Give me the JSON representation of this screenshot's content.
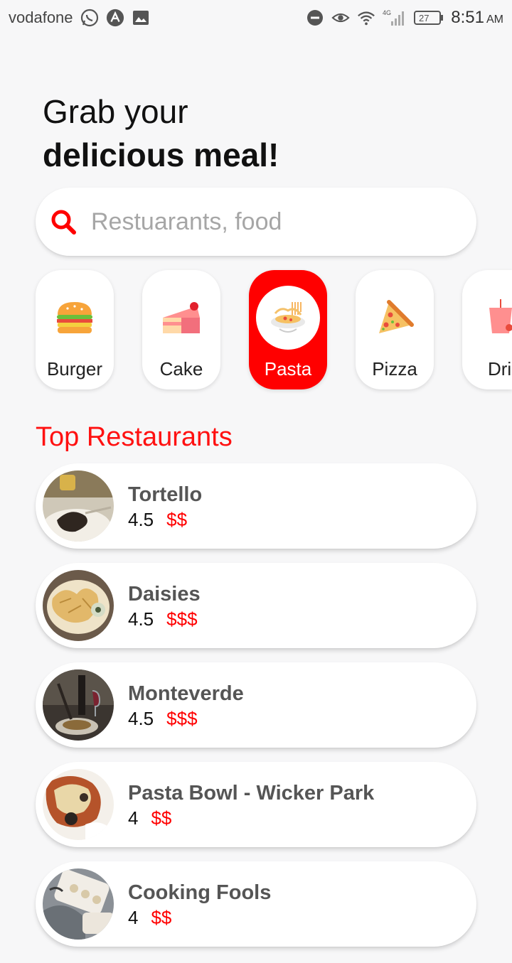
{
  "status_bar": {
    "carrier": "vodafone",
    "time": "8:51",
    "ampm": "AM",
    "battery": "27",
    "network": "4G"
  },
  "greeting": {
    "line1": "Grab your",
    "line2": "delicious meal!"
  },
  "search": {
    "placeholder": "Restuarants, food",
    "accent": "#ff0000"
  },
  "categories": [
    {
      "label": "Burger",
      "icon": "burger-icon",
      "active": false
    },
    {
      "label": "Cake",
      "icon": "cake-icon",
      "active": false
    },
    {
      "label": "Pasta",
      "icon": "pasta-icon",
      "active": true
    },
    {
      "label": "Pizza",
      "icon": "pizza-icon",
      "active": false
    },
    {
      "label": "Drin",
      "icon": "drink-icon",
      "active": false
    }
  ],
  "section": {
    "title": "Top Restaurants"
  },
  "restaurants": [
    {
      "name": "Tortello",
      "rating": "4.5",
      "price": "$$"
    },
    {
      "name": "Daisies",
      "rating": "4.5",
      "price": "$$$"
    },
    {
      "name": "Monteverde",
      "rating": "4.5",
      "price": "$$$"
    },
    {
      "name": "Pasta Bowl - Wicker Park",
      "rating": "4",
      "price": "$$"
    },
    {
      "name": "Cooking Fools",
      "rating": "4",
      "price": "$$"
    }
  ],
  "colors": {
    "accent": "#ff0000",
    "background": "#f7f7f8"
  }
}
